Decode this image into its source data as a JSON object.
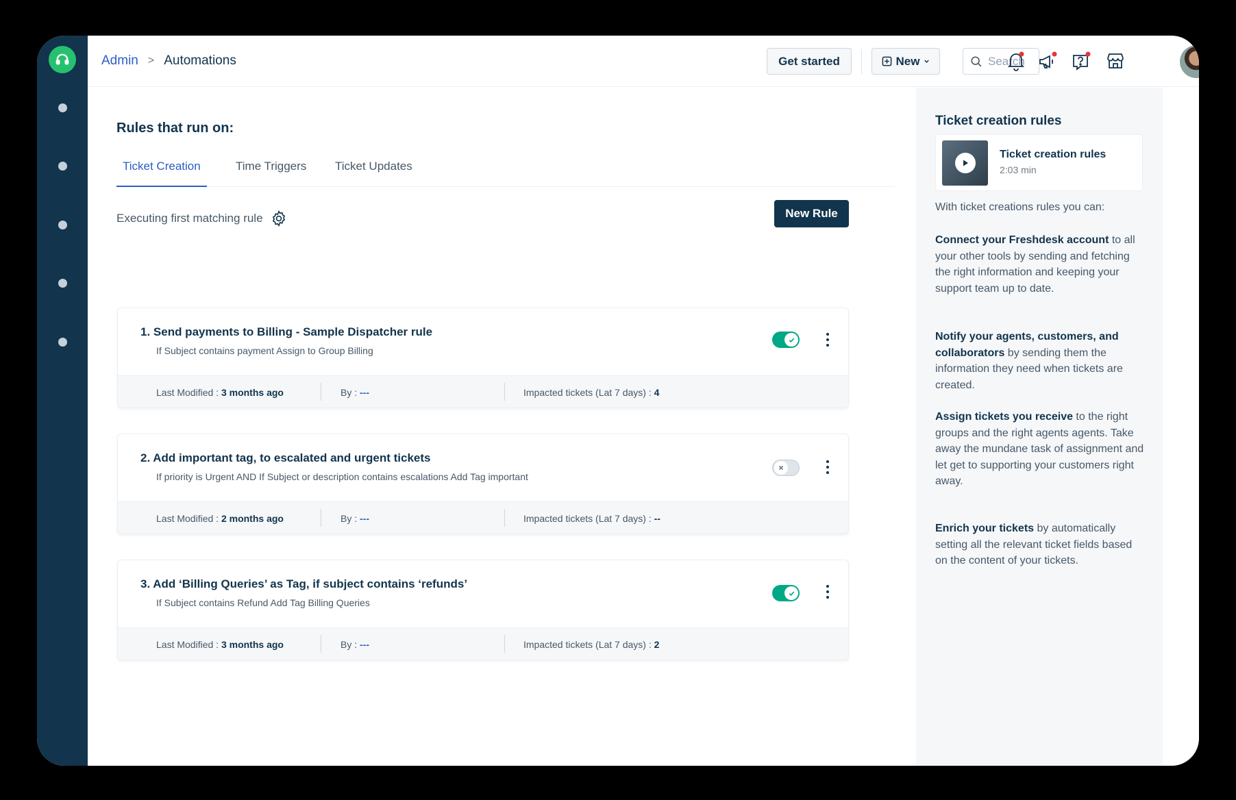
{
  "header": {
    "breadcrumb_root": "Admin",
    "breadcrumb_separator": ">",
    "breadcrumb_current": "Automations",
    "get_started_label": "Get started",
    "new_label": "New",
    "search_placeholder": "Search"
  },
  "main": {
    "title": "Rules that run on:",
    "tabs": [
      {
        "label": "Ticket Creation",
        "active": true
      },
      {
        "label": "Time Triggers",
        "active": false
      },
      {
        "label": "Ticket Updates",
        "active": false
      }
    ],
    "executing_label": "Executing first matching rule",
    "new_rule_label": "New Rule",
    "rules": [
      {
        "title": "1. Send payments to Billing - Sample Dispatcher rule",
        "description": "If Subject contains payment Assign to Group Billing",
        "enabled": true,
        "last_modified_label": "Last Modified :",
        "last_modified_value": "3 months ago",
        "by_label": "By :",
        "by_value": "---",
        "impacted_label": "Impacted tickets (Lat 7 days) :",
        "impacted_value": "4"
      },
      {
        "title": "2. Add important tag, to escalated and urgent tickets",
        "description": "If priority is Urgent AND If Subject or description contains escalations Add Tag important",
        "enabled": false,
        "last_modified_label": "Last Modified :",
        "last_modified_value": "2 months ago",
        "by_label": "By :",
        "by_value": "---",
        "impacted_label": "Impacted tickets (Lat 7 days) :",
        "impacted_value": "--"
      },
      {
        "title": "3. Add ‘Billing Queries’ as Tag, if subject contains ‘refunds’",
        "description": "If Subject contains Refund Add Tag Billing Queries",
        "enabled": true,
        "last_modified_label": "Last Modified :",
        "last_modified_value": "3 months ago",
        "by_label": "By :",
        "by_value": "---",
        "impacted_label": "Impacted tickets (Lat 7 days) :",
        "impacted_value": "2"
      }
    ]
  },
  "panel": {
    "title": "Ticket creation rules",
    "video_title": "Ticket creation rules",
    "video_duration": "2:03 min",
    "intro": "With ticket creations rules you can:",
    "paragraphs": [
      {
        "bold": "Connect your Freshdesk account",
        "rest": " to all your other tools by sending and fetching the right information and keeping your support team up to date."
      },
      {
        "bold": "Notify your agents, customers, and collaborators",
        "rest": " by sending them the information they need when tickets are created."
      },
      {
        "bold": "Assign tickets you receive",
        "rest": " to the right groups and the right agents agents. Take away the mundane task of assignment and let get to supporting your customers right away."
      },
      {
        "bold": "Enrich your tickets",
        "rest": " by automatically setting all the relevant ticket fields based on the content of your tickets."
      }
    ]
  },
  "icons": {
    "logo": "headset-icon",
    "notification": "bell-icon",
    "announcement": "megaphone-icon",
    "help": "help-icon",
    "marketplace": "store-icon",
    "settings": "gear-icon"
  },
  "colors": {
    "sidebar": "#12344d",
    "brand_green": "#25c16f",
    "link_blue": "#2c5cc5",
    "toggle_on": "#00a886",
    "alert_red": "#e43538"
  }
}
